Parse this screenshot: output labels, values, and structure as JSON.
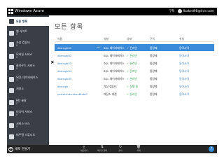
{
  "topbar": {
    "brand": "Windows Azure",
    "credit": "구독",
    "user_email": "fbaked98@live.com"
  },
  "sidebar": {
    "items": [
      {
        "label": "모든 항목",
        "count": "",
        "active": true,
        "icon": "grid-icon"
      },
      {
        "label": "웹 사이트",
        "count": "0",
        "icon": "website-icon"
      },
      {
        "label": "가상 컴퓨터",
        "count": "0",
        "icon": "vm-icon"
      },
      {
        "label": "모바일 서비스",
        "count": "0",
        "icon": "mobile-icon"
      },
      {
        "label": "클라우드 서비스",
        "count": "0",
        "icon": "cloud-icon"
      },
      {
        "label": "SQL 데이터베이스",
        "count": "7",
        "icon": "database-icon"
      },
      {
        "label": "저장소",
        "count": "",
        "icon": "storage-icon"
      },
      {
        "label": "HD 통찰",
        "count": "0",
        "icon": "hdinsight-icon"
      },
      {
        "label": "미디어 서비스",
        "count": "0",
        "icon": "media-icon"
      },
      {
        "label": "서비스 버스",
        "count": "0",
        "icon": "bus-icon"
      },
      {
        "label": "비주얼 스튜디오",
        "count": "",
        "icon": "visualstudio-icon"
      }
    ]
  },
  "main": {
    "title": "모든 항목",
    "columns": [
      "이름",
      "유형",
      "상태",
      "구독",
      "위치"
    ],
    "rows": [
      {
        "name": "dbmsgh01",
        "type": "SQL 데이터베이스",
        "status": "✓ 온라인",
        "subscription": "종량제",
        "location": "동아시아",
        "selected": true
      },
      {
        "name": "dbmsgh02",
        "type": "SQL 데이터베이스",
        "status": "✓ 온라인",
        "subscription": "종량제",
        "location": "동아시아"
      },
      {
        "name": "dbmsgh03",
        "type": "SQL 데이터베이스",
        "status": "✓ 온라인",
        "subscription": "종량제",
        "location": "동아시아"
      },
      {
        "name": "dbmsgh04",
        "type": "SQL 데이터베이스",
        "status": "✓ 온라인",
        "subscription": "종량제",
        "location": "동아시아"
      },
      {
        "name": "dbmsgh05",
        "type": "SQL 데이터베이스",
        "status": "✓ 온라인",
        "subscription": "종량제",
        "location": "동아시아"
      },
      {
        "name": "dbmsgh",
        "type": "가상 컴퓨터",
        "status": "✓ 실행 중",
        "subscription": "종량제",
        "location": "동아시아"
      },
      {
        "name": "portalvhdsrhbxz8txbt1",
        "type": "저장소 계정",
        "status": "✓ 온라인",
        "subscription": "종량제",
        "location": "동아시아"
      }
    ]
  },
  "commandbar": {
    "new_label": "새로 만들기",
    "commands": [
      {
        "label": "내보내기",
        "icon": "export-icon",
        "glyph": "⤓"
      },
      {
        "label": "복구할 항목",
        "icon": "restore-icon",
        "glyph": "⇅"
      },
      {
        "label": "관리",
        "icon": "manage-icon",
        "glyph": "↻"
      },
      {
        "label": "삭제",
        "icon": "delete-icon",
        "glyph": "🗑"
      }
    ],
    "help": "?"
  }
}
